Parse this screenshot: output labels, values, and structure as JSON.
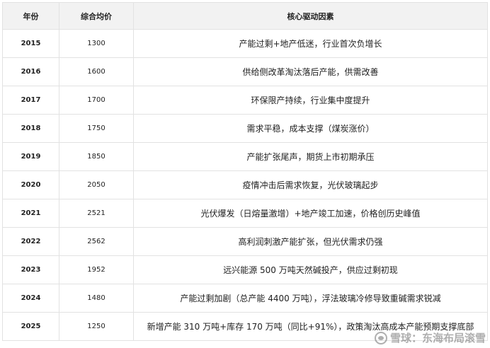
{
  "table": {
    "headers": [
      "年份",
      "综合均价",
      "核心驱动因素"
    ],
    "rows": [
      {
        "year": "2015",
        "price": "1300",
        "driver": "产能过剩+地产低迷，行业首次负增长"
      },
      {
        "year": "2016",
        "price": "1600",
        "driver": "供给侧改革淘汰落后产能，供需改善"
      },
      {
        "year": "2017",
        "price": "1700",
        "driver": "环保限产持续，行业集中度提升"
      },
      {
        "year": "2018",
        "price": "1750",
        "driver": "需求平稳，成本支撑（煤炭涨价）"
      },
      {
        "year": "2019",
        "price": "1850",
        "driver": "产能扩张尾声，期货上市初期承压"
      },
      {
        "year": "2020",
        "price": "2050",
        "driver": "疫情冲击后需求恢复，光伏玻璃起步"
      },
      {
        "year": "2021",
        "price": "2521",
        "driver": "光伏爆发（日熔量激增）+地产竣工加速，价格创历史峰值"
      },
      {
        "year": "2022",
        "price": "2562",
        "driver": "高利润刺激产能扩张，但光伏需求仍强"
      },
      {
        "year": "2023",
        "price": "1952",
        "driver": "远兴能源 500 万吨天然碱投产，供应过剩初现"
      },
      {
        "year": "2024",
        "price": "1480",
        "driver": "产能过剩加剧（总产能 4400 万吨），浮法玻璃冷修导致重碱需求锐减"
      },
      {
        "year": "2025",
        "price": "1250",
        "driver": "新增产能 310 万吨+库存 170 万吨（同比+91%），政策淘汰高成本产能预期支撑底部"
      }
    ]
  },
  "watermark": {
    "text": "雪球：东海布局滚雪",
    "icon": "snowball-logo-icon"
  }
}
